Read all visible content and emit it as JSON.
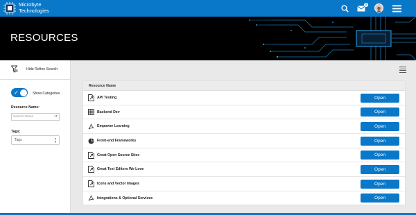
{
  "app": {
    "brand_line1": "Microbyte",
    "brand_line2": "Technologies",
    "accent_color": "#0a78c8",
    "notification_count": "0"
  },
  "banner": {
    "title": "RESOURCES"
  },
  "sidebar": {
    "hide_refine_label": "Hide Refine Search",
    "show_categories_label": "Show Categories",
    "show_categories_on": true,
    "resource_name_label": "Resource Name:",
    "search_placeholder": "Search Name",
    "tags_label": "Tags:",
    "tags_value": "Tags"
  },
  "table": {
    "header": "Resource Name",
    "open_label": "Open",
    "rows": [
      {
        "name": "API Testing",
        "icon": "document-link-icon"
      },
      {
        "name": "Backend Dev",
        "icon": "table-icon"
      },
      {
        "name": "Empower Learning",
        "icon": "pdf-icon"
      },
      {
        "name": "Front-end Frameworks",
        "icon": "pie-chart-icon"
      },
      {
        "name": "Great Open Source Sites",
        "icon": "document-link-icon"
      },
      {
        "name": "Great Text Editors We Love",
        "icon": "document-link-icon"
      },
      {
        "name": "Icons and Vector Images",
        "icon": "document-link-icon"
      },
      {
        "name": "Integrations & Optional Services",
        "icon": "pdf-icon"
      }
    ]
  }
}
